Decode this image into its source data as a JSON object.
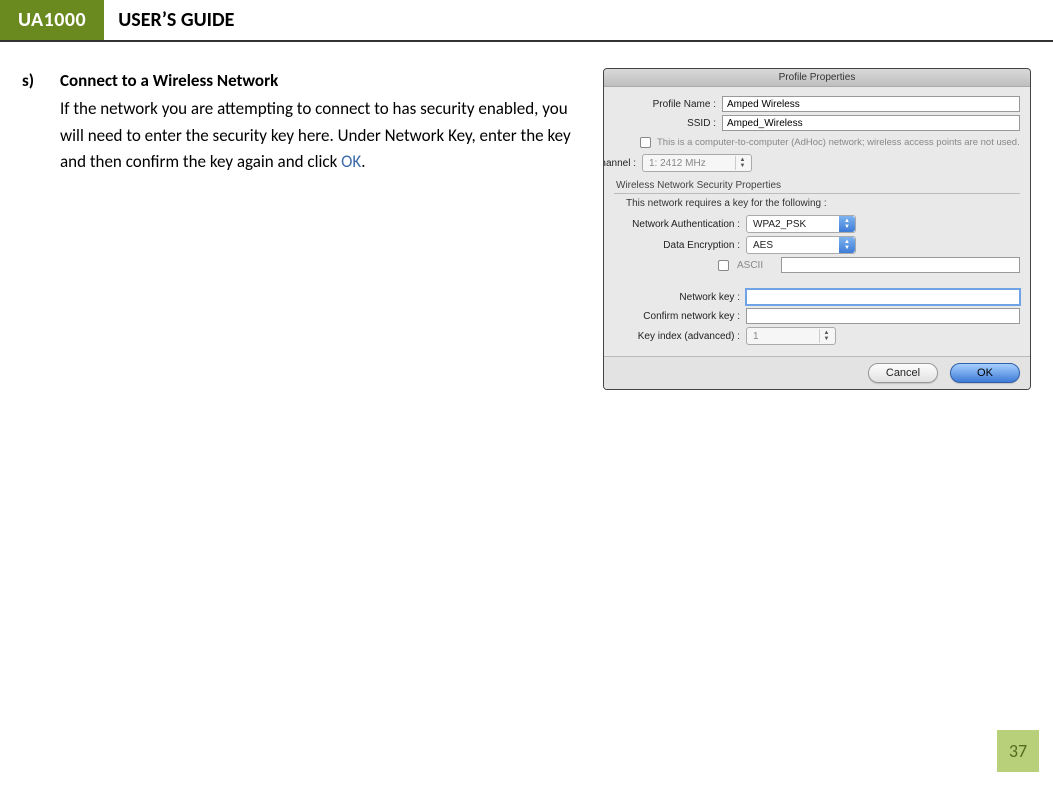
{
  "header": {
    "product": "UA1000",
    "title": "USER’S GUIDE"
  },
  "step": {
    "letter": "s)",
    "heading": "Connect to a Wireless Network",
    "body_prefix": "If the network you are attempting to connect to has security enabled, you will need to enter the security key here. Under Network Key, enter the key and then confirm the key again and click ",
    "ok": "OK",
    "body_suffix": "."
  },
  "dialog": {
    "title": "Profile Properties",
    "labels": {
      "profile_name": "Profile Name :",
      "ssid": "SSID :",
      "adhoc": "This is a computer-to-computer (AdHoc) network; wireless access points are not used.",
      "channel": "Channel :",
      "section": "Wireless Network Security Properties",
      "note": "This network requires a key for the following :",
      "auth": "Network Authentication :",
      "encryption": "Data Encryption :",
      "ascii": "ASCII",
      "netkey": "Network key :",
      "confirmkey": "Confirm network key :",
      "keyindex": "Key index (advanced) :"
    },
    "values": {
      "profile_name": "Amped Wireless",
      "ssid": "Amped_Wireless",
      "channel": "1: 2412 MHz",
      "auth": "WPA2_PSK",
      "encryption": "AES",
      "netkey": "",
      "confirmkey": "",
      "keyindex": "1"
    },
    "buttons": {
      "cancel": "Cancel",
      "ok": "OK"
    }
  },
  "page_number": "37"
}
